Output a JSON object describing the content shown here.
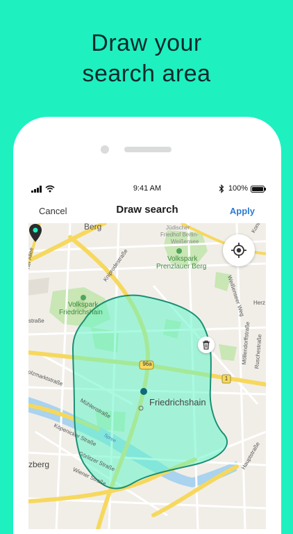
{
  "headline": {
    "line1": "Draw your",
    "line2": "search area"
  },
  "status": {
    "time": "9:41 AM",
    "battery": "100%"
  },
  "nav": {
    "cancel": "Cancel",
    "title": "Draw search",
    "apply": "Apply"
  },
  "map": {
    "labels": {
      "berg": "Berg",
      "judischer": "Jüdischer",
      "friedhof": "Friedhof Berlin-",
      "weissensee": "Weißensee",
      "volkspark1a": "Volkspark",
      "volkspark1b": "Prenzlauer Berg",
      "volkspark2a": "Volkspark",
      "volkspark2b": "Friedrichshain",
      "friedrichshain": "Friedrichshain",
      "kniprode": "Kniprodestraße",
      "weissenseer": "Weißenseer Weg",
      "herz": "Herz",
      "mollendorf": "Möllendorffstraße",
      "rusche": "Ruschestraße",
      "konto": "Konto",
      "allee": "ner Allee",
      "strasse_left": "straße",
      "holz": "olzmarktstraße",
      "mühlen": "Mühlenstraße",
      "spree": "Spree",
      "kopenicker": "Köpenicker Straße",
      "gorlitzer": "Görlitzer Straße",
      "wiener": "Wiener Straße",
      "zberg": "zberg",
      "haupt": "Hauptstraße",
      "road96a": "96a",
      "road1": "1"
    },
    "polygon_color": "#1a8f73",
    "fill_color": "#63f5c8"
  },
  "icons": {
    "locate": "crosshair-icon",
    "trash": "trash-icon",
    "pin": "map-pin-icon"
  }
}
